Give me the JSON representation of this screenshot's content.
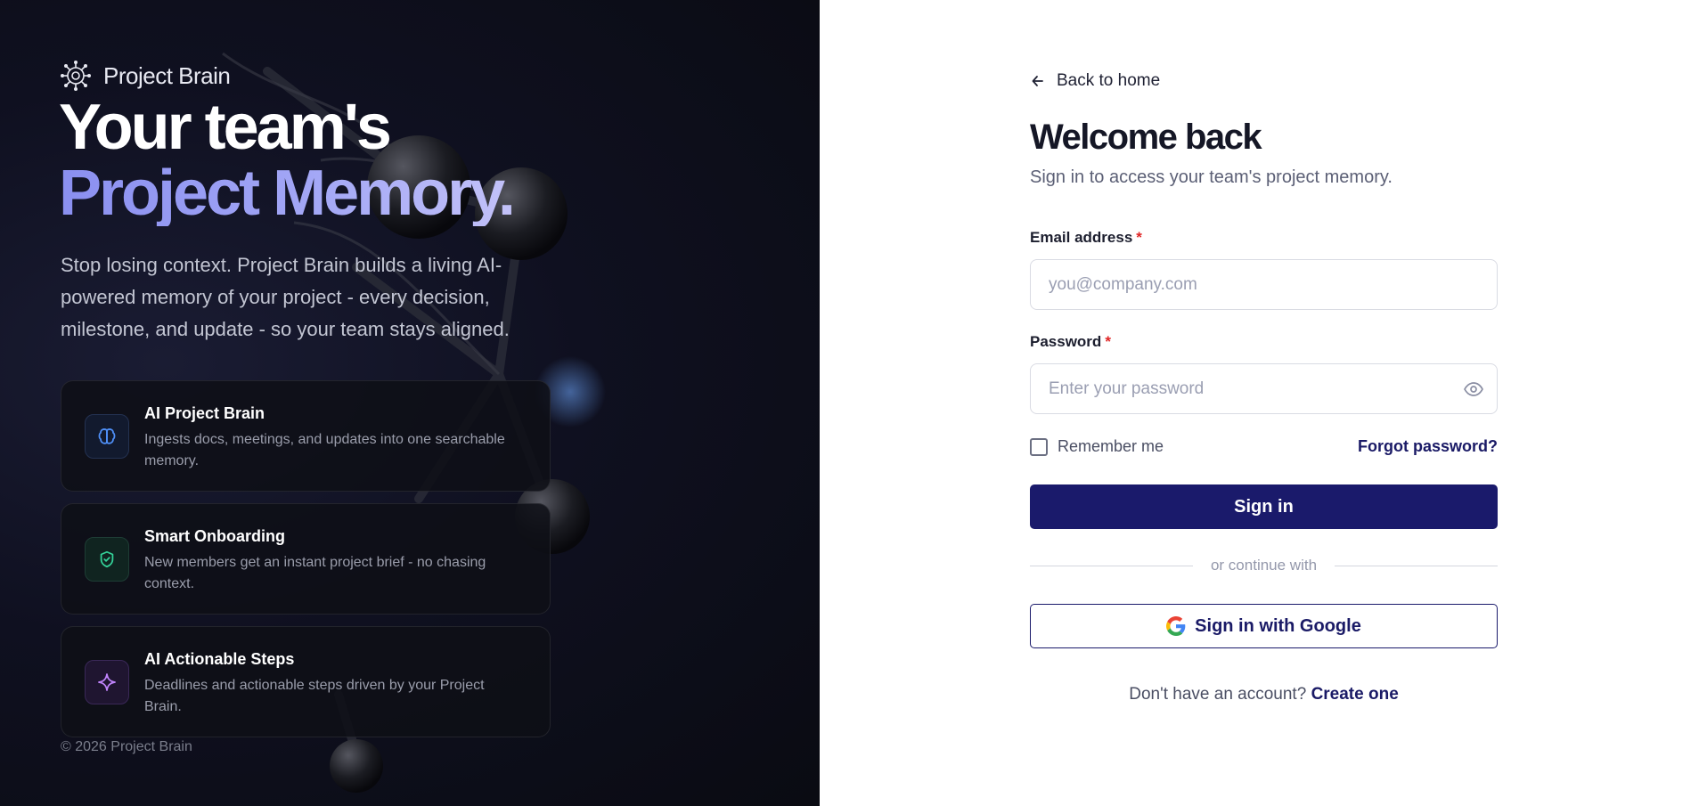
{
  "brand": {
    "name": "Project Brain",
    "logo_icon": "network-brain-icon"
  },
  "hero": {
    "line1": "Your team's",
    "line2": "Project Memory.",
    "description": "Stop losing context. Project Brain builds a living AI-powered memory of your project - every decision, milestone, and update - so your team stays aligned."
  },
  "features": [
    {
      "icon": "brain-icon",
      "title": "AI Project Brain",
      "description": "Ingests docs, meetings, and updates into one searchable memory.",
      "accent": "#4f8ff7"
    },
    {
      "icon": "shield-check-icon",
      "title": "Smart Onboarding",
      "description": "New members get an instant project brief - no chasing context.",
      "accent": "#34d399"
    },
    {
      "icon": "sparkle-icon",
      "title": "AI Actionable Steps",
      "description": "Deadlines and actionable steps driven by your Project Brain.",
      "accent": "#c084fc"
    }
  ],
  "footer": {
    "copyright": "© 2026 Project Brain"
  },
  "form": {
    "back_label": "Back to home",
    "title": "Welcome back",
    "subtitle": "Sign in to access your team's project memory.",
    "email": {
      "label": "Email address",
      "required_mark": "*",
      "placeholder": "you@company.com",
      "value": ""
    },
    "password": {
      "label": "Password",
      "required_mark": "*",
      "placeholder": "Enter your password",
      "value": ""
    },
    "remember_label": "Remember me",
    "forgot_label": "Forgot password?",
    "submit_label": "Sign in",
    "divider_label": "or continue with",
    "google_label": "Sign in with Google",
    "signup_prompt": "Don't have an account?",
    "signup_link": "Create one"
  },
  "colors": {
    "primary": "#1a1a6b",
    "hero_gradient_start": "#8a8ff0",
    "required": "#e02424",
    "left_background": "#0f1020"
  }
}
